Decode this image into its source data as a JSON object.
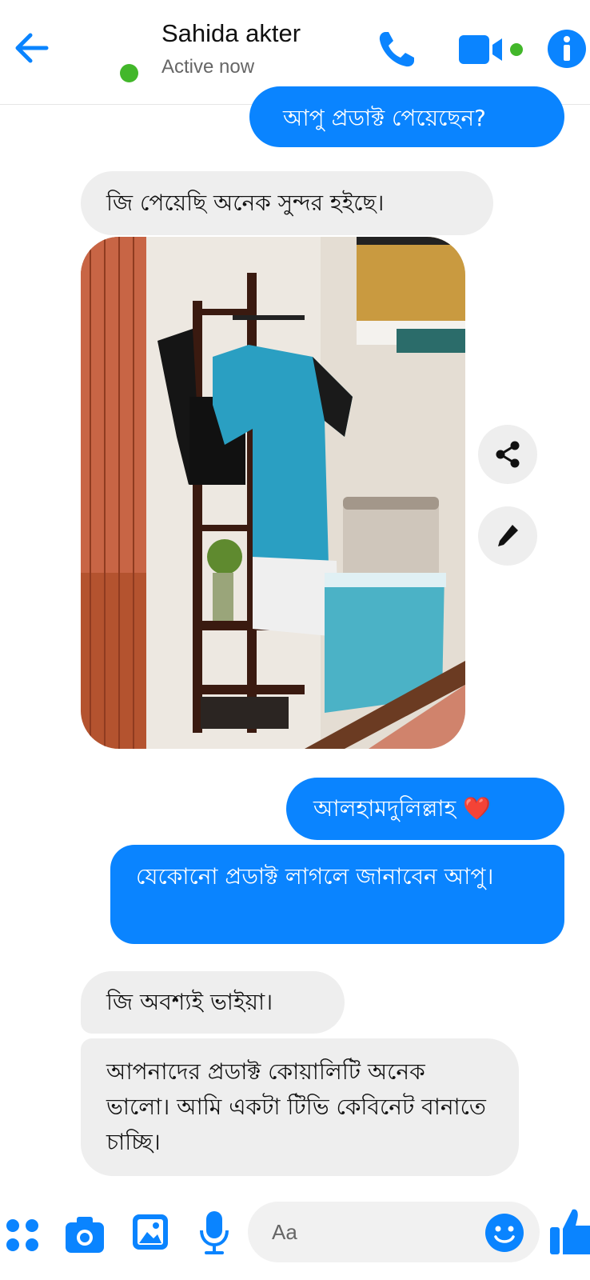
{
  "header": {
    "contact_name": "Sahida akter",
    "status": "Active now"
  },
  "messages": [
    {
      "side": "out",
      "text": "আপু প্রডাক্ট পেয়েছেন?"
    },
    {
      "side": "in",
      "text": "জি পেয়েছি অনেক সুন্দর হইছে।"
    },
    {
      "side": "in",
      "type": "photo"
    },
    {
      "side": "out",
      "text": "আলহামদুলিল্লাহ ❤️"
    },
    {
      "side": "out",
      "text": "যেকোনো প্রডাক্ট লাগলে জানাবেন আপু।"
    },
    {
      "side": "in",
      "text": "জি অবশ্যই ভাইয়া।"
    },
    {
      "side": "in",
      "text": "আপনাদের প্রডাক্ট কোয়ালিটি অনেক ভালো। আমি একটা টিভি কেবিনেট বানাতে চাচ্ছি।"
    }
  ],
  "composer": {
    "placeholder": "Aa"
  },
  "colors": {
    "accent": "#0a84ff",
    "incoming_bubble": "#eeeeee",
    "active_dot": "#42b72a"
  },
  "icons": [
    "back-arrow-icon",
    "phone-icon",
    "video-camera-icon",
    "info-icon",
    "share-icon",
    "edit-pencil-icon",
    "apps-grid-icon",
    "camera-icon",
    "gallery-icon",
    "microphone-icon",
    "emoji-icon",
    "thumbs-up-icon"
  ]
}
